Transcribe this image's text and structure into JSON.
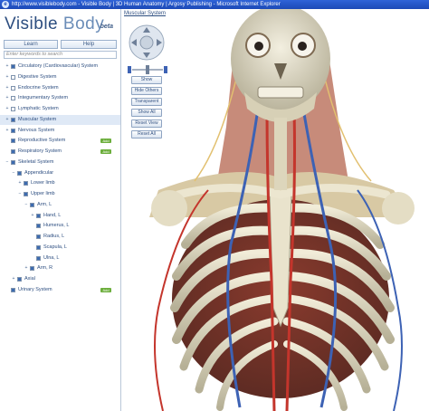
{
  "window": {
    "title": "http://www.visiblebody.com - Visible Body | 3D Human Anatomy | Argosy Publishing - Microsoft Internet Explorer"
  },
  "sidebar": {
    "logo": {
      "word_a": "Visible",
      "word_b": "Body",
      "beta": "beta"
    },
    "learn_label": "Learn",
    "help_label": "Help",
    "search_placeholder": "Enter keywords to search",
    "tree": [
      {
        "label": "Circulatory (Cardiovascular) System",
        "level": 0,
        "expander": "+",
        "checked": true,
        "add": ""
      },
      {
        "label": "Digestive System",
        "level": 0,
        "expander": "+",
        "checked": false,
        "add": ""
      },
      {
        "label": "Endocrine System",
        "level": 0,
        "expander": "+",
        "checked": false,
        "add": ""
      },
      {
        "label": "Integumentary System",
        "level": 0,
        "expander": "+",
        "checked": false,
        "add": ""
      },
      {
        "label": "Lymphatic System",
        "level": 0,
        "expander": "+",
        "checked": false,
        "add": ""
      },
      {
        "label": "Muscular System",
        "level": 0,
        "expander": "+",
        "checked": true,
        "add": "",
        "selected": true
      },
      {
        "label": "Nervous System",
        "level": 0,
        "expander": "+",
        "checked": true,
        "add": ""
      },
      {
        "label": "Reproductive System",
        "level": 0,
        "expander": "",
        "checked": true,
        "add": "Add"
      },
      {
        "label": "Respiratory System",
        "level": 0,
        "expander": "",
        "checked": true,
        "add": "Add"
      },
      {
        "label": "Skeletal System",
        "level": 0,
        "expander": "−",
        "checked": true,
        "add": ""
      },
      {
        "label": "Appendicular",
        "level": 1,
        "expander": "−",
        "checked": true,
        "add": ""
      },
      {
        "label": "Lower limb",
        "level": 2,
        "expander": "+",
        "checked": true,
        "add": ""
      },
      {
        "label": "Upper limb",
        "level": 2,
        "expander": "−",
        "checked": true,
        "add": ""
      },
      {
        "label": "Arm, L",
        "level": 3,
        "expander": "−",
        "checked": true,
        "add": ""
      },
      {
        "label": "Hand, L",
        "level": 4,
        "expander": "+",
        "checked": true,
        "add": ""
      },
      {
        "label": "Humerus, L",
        "level": 4,
        "expander": "",
        "checked": true,
        "add": ""
      },
      {
        "label": "Radius, L",
        "level": 4,
        "expander": "",
        "checked": true,
        "add": ""
      },
      {
        "label": "Scapula, L",
        "level": 4,
        "expander": "",
        "checked": true,
        "add": ""
      },
      {
        "label": "Ulna, L",
        "level": 4,
        "expander": "",
        "checked": true,
        "add": ""
      },
      {
        "label": "Arm, R",
        "level": 3,
        "expander": "+",
        "checked": true,
        "add": ""
      },
      {
        "label": "Axial",
        "level": 1,
        "expander": "+",
        "checked": true,
        "add": ""
      },
      {
        "label": "Urinary System",
        "level": 0,
        "expander": "",
        "checked": true,
        "add": "Add"
      }
    ]
  },
  "viewer": {
    "title": "Muscular System",
    "buttons": [
      {
        "label": "Show"
      },
      {
        "label": "Hide Others"
      },
      {
        "label": "Transparent"
      },
      {
        "label": "Show All"
      },
      {
        "label": "Reset View"
      },
      {
        "label": "Reset All"
      }
    ]
  },
  "colors": {
    "bone": "#e6e0c8",
    "artery": "#c4352c",
    "vein": "#3d62b4",
    "nerve": "#e2c070",
    "accent": "#2d4e80"
  },
  "icons": [
    "ie-icon",
    "nav-pad-icon",
    "zoom-slider-icon",
    "expand-icon",
    "checkbox-icon"
  ]
}
